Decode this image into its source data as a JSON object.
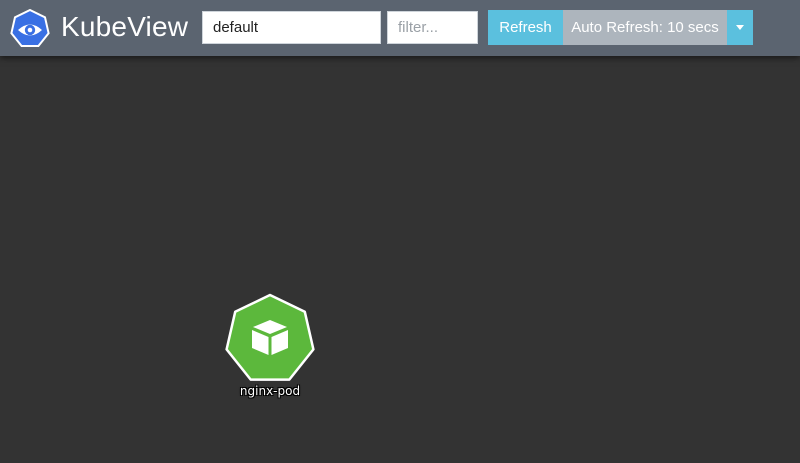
{
  "app": {
    "title": "KubeView",
    "logo_icon": "eye-icon",
    "brand_color": "#3970e4"
  },
  "toolbar": {
    "namespace_value": "default",
    "filter_placeholder": "filter...",
    "filter_value": "",
    "refresh_label": "Refresh",
    "auto_refresh_label": "Auto Refresh: 10 secs",
    "dropdown_icon": "caret-down-icon",
    "colors": {
      "navbar": "#5b6470",
      "refresh": "#5bc0de",
      "auto_refresh": "#adb5bd"
    }
  },
  "graph": {
    "background": "#333333",
    "nodes": [
      {
        "label": "nginx-pod",
        "icon": "pod-cube-icon",
        "color": "#5cb83c"
      }
    ]
  }
}
